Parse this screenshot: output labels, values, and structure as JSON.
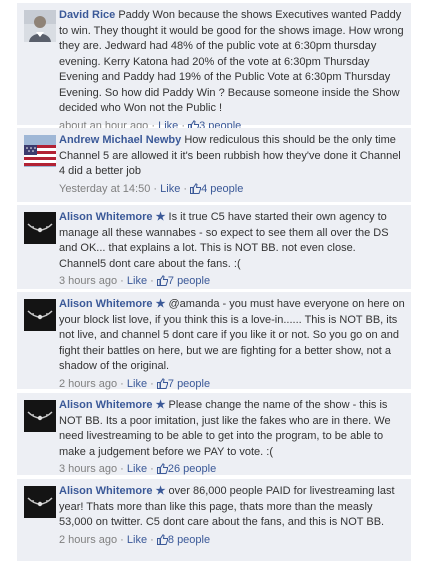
{
  "comments": [
    {
      "author": "David Rice",
      "text": "Paddy Won because the shows Executives wanted Paddy to win. They thought it would be good for the shows image. How wrong they are. Jedward had 48% of the public vote at 6:30pm thursday evening. Kerry Katona had 20% of the vote at 6:30pm Thursday Evening and Paddy had 19% of the Public Vote at 6:30pm Thursday Evening. So how did Paddy Win ? Because someone inside the Show decided who Won not the Public !",
      "time": "about an hour ago",
      "like_label": "Like",
      "people": "3 people",
      "avatar": "person-photo"
    },
    {
      "author": "Andrew Michael Newby",
      "text": "How rediculous this should be the only time Channel 5 are allowed it it's been rubbish how they've done it Channel 4 did a better job",
      "time": "Yesterday at 14:50",
      "like_label": "Like",
      "people": "4 people",
      "avatar": "flag-photo"
    },
    {
      "author": "Alison Whitemore",
      "star": "★",
      "text": "Is it true C5 have started their own agency to manage all these wannabes - so expect to see them all over the DS and OK... that explains a lot. This is NOT BB. not even close. Channel5 dont care about the fans. :(",
      "time": "3 hours ago",
      "like_label": "Like",
      "people": "7 people",
      "avatar": "dark-necklace-photo"
    },
    {
      "author": "Alison Whitemore",
      "star": "★",
      "text": "@amanda - you must have everyone on here on your block list love, if you think this is a love-in...... This is NOT BB, its not live, and channel 5 dont care if you like it or not. So you go on and fight their battles on here, but we are fighting for a better show, not a shadow of the original.",
      "time": "2 hours ago",
      "like_label": "Like",
      "people": "7 people",
      "avatar": "dark-necklace-photo"
    },
    {
      "author": "Alison Whitemore",
      "star": "★",
      "text": "Please change the name of the show - this is NOT BB. Its a poor imitation, just like the fakes who are in there. We need livestreaming to be able to get into the program, to be able to make a judgement before we PAY to vote. :(",
      "time": "3 hours ago",
      "like_label": "Like",
      "people": "26 people",
      "avatar": "dark-necklace-photo"
    },
    {
      "author": "Alison Whitemore",
      "star": "★",
      "text": "over 86,000 people PAID for livestreaming last year! Thats more than like this page, thats more than the measly 53,000 on twitter. C5 dont care about the fans, and this is NOT BB.",
      "time": "2 hours ago",
      "like_label": "Like",
      "people": "8 people",
      "avatar": "dark-necklace-photo"
    }
  ],
  "separator": "·",
  "colors": {
    "link": "#3b5998",
    "comment_bg": "#edeff4",
    "meta_text": "#808080"
  }
}
